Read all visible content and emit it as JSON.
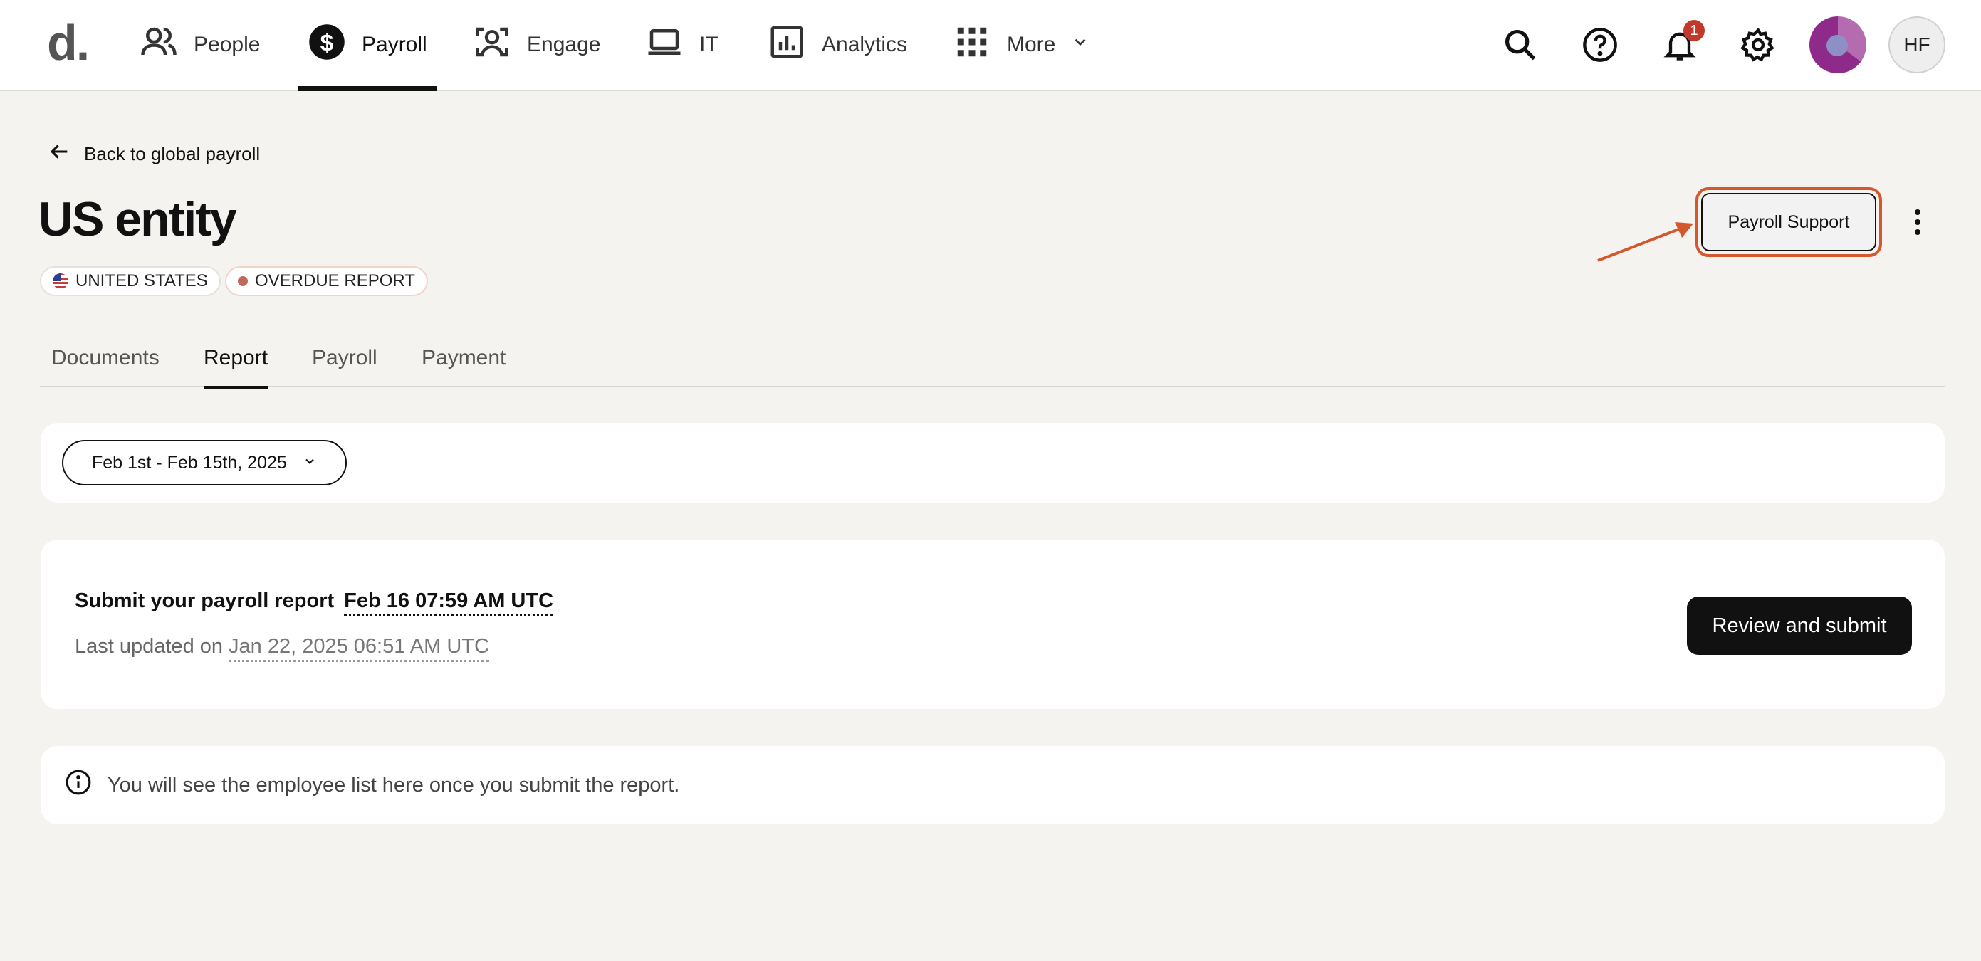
{
  "nav": {
    "logo": "d.",
    "items": [
      {
        "label": "People",
        "icon": "people-icon"
      },
      {
        "label": "Payroll",
        "icon": "dollar-icon",
        "active": true
      },
      {
        "label": "Engage",
        "icon": "engage-icon"
      },
      {
        "label": "IT",
        "icon": "laptop-icon"
      },
      {
        "label": "Analytics",
        "icon": "analytics-icon"
      },
      {
        "label": "More",
        "icon": "grid-icon"
      }
    ],
    "notification_count": "1",
    "user_initials": "HF"
  },
  "header": {
    "back_label": "Back to global payroll",
    "title": "US entity",
    "chips": [
      "UNITED STATES",
      "OVERDUE REPORT"
    ],
    "support_button": "Payroll Support"
  },
  "tabs": [
    {
      "label": "Documents"
    },
    {
      "label": "Report",
      "active": true
    },
    {
      "label": "Payroll"
    },
    {
      "label": "Payment"
    }
  ],
  "period": {
    "label": "Feb 1st - Feb 15th, 2025"
  },
  "report": {
    "submit_label": "Submit your payroll report",
    "deadline": "Feb 16 07:59 AM UTC",
    "updated_prefix": "Last updated on",
    "updated_date": "Jan 22, 2025 06:51 AM UTC",
    "review_button": "Review and submit"
  },
  "info": {
    "message": "You will see the employee list here once you submit the report."
  },
  "colors": {
    "accent": "#111111",
    "highlight": "#d4572d",
    "overdue_dot": "#c0695c",
    "background": "#f4f3f0"
  }
}
